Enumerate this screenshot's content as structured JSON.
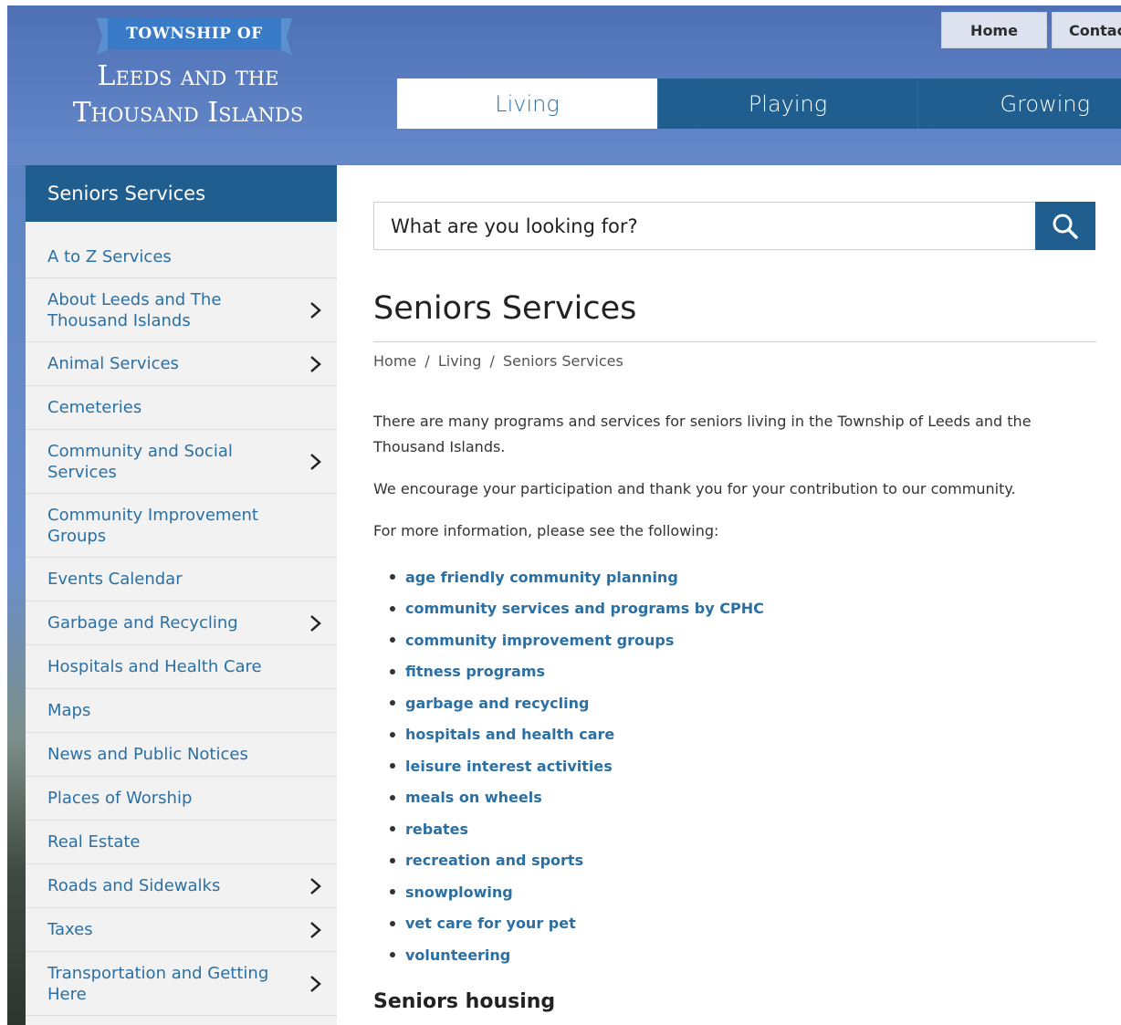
{
  "logo": {
    "banner": "TOWNSHIP OF",
    "line1": "Leeds and the",
    "line2": "Thousand Islands"
  },
  "top_nav": {
    "home": "Home",
    "contact": "Contac"
  },
  "main_tabs": {
    "living": "Living",
    "playing": "Playing",
    "growing": "Growing"
  },
  "sidebar": {
    "title": "Seniors Services",
    "items": [
      {
        "label": "A to Z Services",
        "has_children": false
      },
      {
        "label": "About Leeds and The Thousand Islands",
        "has_children": true
      },
      {
        "label": "Animal Services",
        "has_children": true
      },
      {
        "label": "Cemeteries",
        "has_children": false
      },
      {
        "label": "Community and Social Services",
        "has_children": true
      },
      {
        "label": "Community Improvement Groups",
        "has_children": false
      },
      {
        "label": "Events Calendar",
        "has_children": false
      },
      {
        "label": "Garbage and Recycling",
        "has_children": true
      },
      {
        "label": "Hospitals and Health Care",
        "has_children": false
      },
      {
        "label": "Maps",
        "has_children": false
      },
      {
        "label": "News and Public Notices",
        "has_children": false
      },
      {
        "label": "Places of Worship",
        "has_children": false
      },
      {
        "label": "Real Estate",
        "has_children": false
      },
      {
        "label": "Roads and Sidewalks",
        "has_children": true
      },
      {
        "label": "Taxes",
        "has_children": true
      },
      {
        "label": "Transportation and Getting Here",
        "has_children": true
      }
    ]
  },
  "search": {
    "placeholder": "What are you looking for?",
    "icon": "search-icon"
  },
  "content": {
    "title": "Seniors Services",
    "breadcrumb": [
      "Home",
      "Living",
      "Seniors Services"
    ],
    "breadcrumb_sep": "/",
    "paragraphs": [
      "There are many programs and services for seniors living in the Township of Leeds and the Thousand Islands.",
      "We encourage your participation and thank you for your contribution to our community.",
      "For more information, please see the following:"
    ],
    "links": [
      "age friendly community planning",
      "community services and programs by CPHC",
      "community improvement groups",
      "fitness programs",
      "garbage and recycling",
      "hospitals and health care",
      "leisure interest activities",
      "meals on wheels",
      "rebates",
      "recreation and sports",
      "snowplowing",
      "vet care for your pet",
      "volunteering"
    ],
    "section_heading": "Seniors housing"
  },
  "colors": {
    "brand_blue": "#1f5e8e",
    "link_blue": "#2b6fa3",
    "header_blue": "#5b7fc2"
  }
}
